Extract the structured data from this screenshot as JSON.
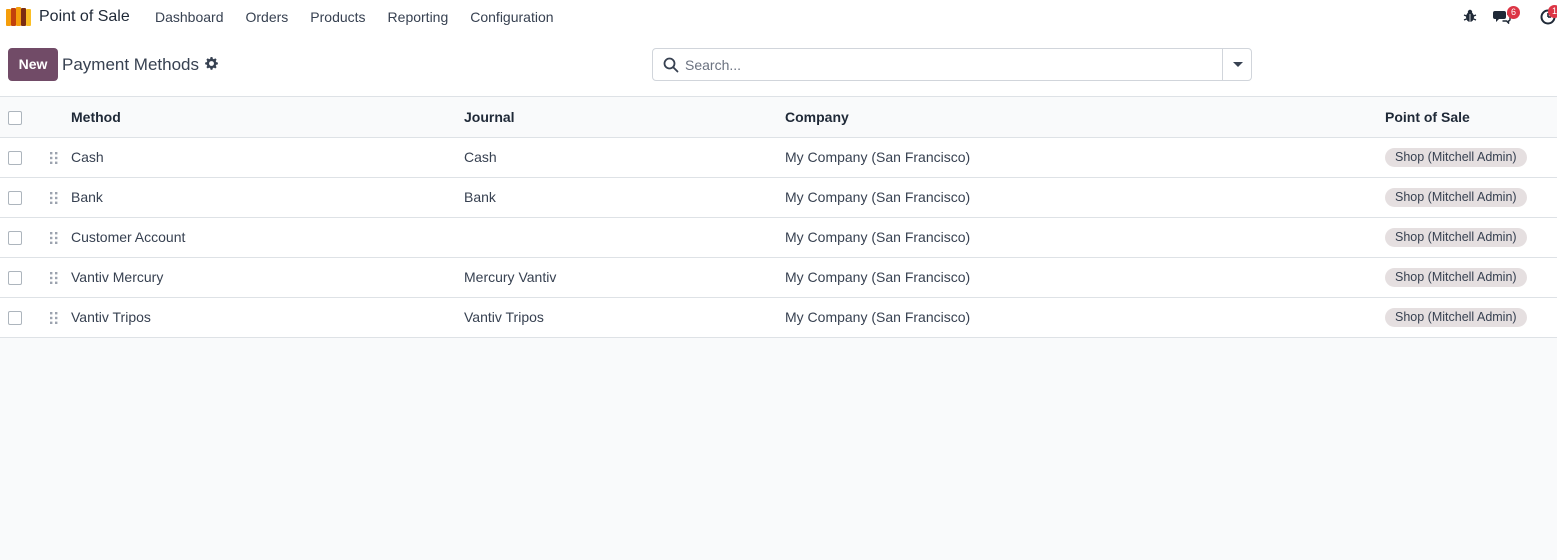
{
  "navbar": {
    "app_title": "Point of Sale",
    "menu": [
      "Dashboard",
      "Orders",
      "Products",
      "Reporting",
      "Configuration"
    ],
    "systray": {
      "messages_badge": "6",
      "activity_badge": "1"
    }
  },
  "control_panel": {
    "new_label": "New",
    "title": "Payment Methods",
    "search_placeholder": "Search..."
  },
  "table": {
    "columns": [
      "Method",
      "Journal",
      "Company",
      "Point of Sale"
    ],
    "rows": [
      {
        "method": "Cash",
        "journal": "Cash",
        "company": "My Company (San Francisco)",
        "pos": "Shop (Mitchell Admin)"
      },
      {
        "method": "Bank",
        "journal": "Bank",
        "company": "My Company (San Francisco)",
        "pos": "Shop (Mitchell Admin)"
      },
      {
        "method": "Customer Account",
        "journal": "",
        "company": "My Company (San Francisco)",
        "pos": "Shop (Mitchell Admin)"
      },
      {
        "method": "Vantiv Mercury",
        "journal": "Mercury Vantiv",
        "company": "My Company (San Francisco)",
        "pos": "Shop (Mitchell Admin)"
      },
      {
        "method": "Vantiv Tripos",
        "journal": "Vantiv Tripos",
        "company": "My Company (San Francisco)",
        "pos": "Shop (Mitchell Admin)"
      }
    ]
  },
  "colors": {
    "brand": "#714b67",
    "badge": "#dc3545",
    "tag_bg": "#e5dfe0"
  }
}
